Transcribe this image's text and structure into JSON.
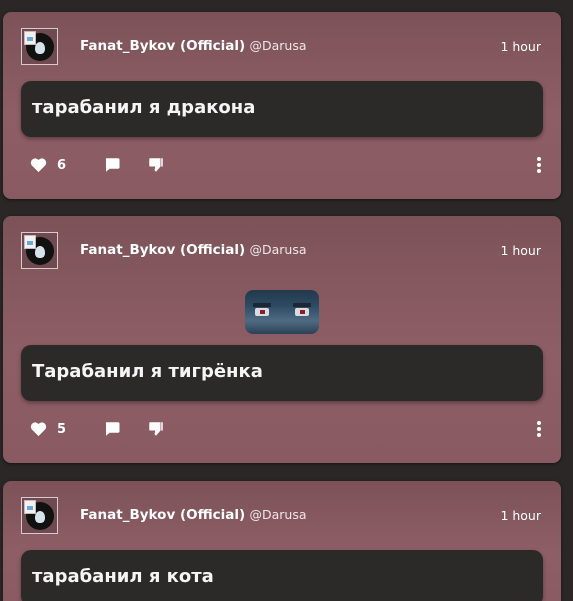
{
  "posts": [
    {
      "author": "Fanat_Bykov (Official)",
      "handle": "@Darusa",
      "time": "1 hour",
      "text": "тарабанил я дракона",
      "likes": "6",
      "has_image": false
    },
    {
      "author": "Fanat_Bykov (Official)",
      "handle": "@Darusa",
      "time": "1 hour",
      "text": "Тарабанил я тигрёнка",
      "likes": "5",
      "has_image": true
    },
    {
      "author": "Fanat_Bykov (Official)",
      "handle": "@Darusa",
      "time": "1 hour",
      "text": "тарабанил я кота",
      "likes": "",
      "has_image": false
    }
  ],
  "icons": {
    "like": "heart-icon",
    "comment": "comment-icon",
    "dislike": "thumbs-down-icon",
    "more": "more-vertical-icon"
  },
  "colors": {
    "card_background": "#8e5e66",
    "content_background": "#2b2a29",
    "page_background": "#2a2726"
  }
}
